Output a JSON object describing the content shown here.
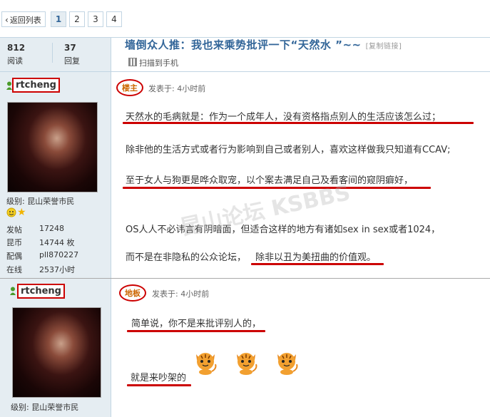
{
  "pager": {
    "back_label": "返回列表",
    "pages": [
      "1",
      "2",
      "3",
      "4"
    ],
    "current": "1"
  },
  "stats": {
    "views_num": "812",
    "views_label": "阅读",
    "replies_num": "37",
    "replies_label": "回复"
  },
  "thread": {
    "title": "墙倒众人推：我也来乘势批评一下“天然水 ”~~",
    "copy_link": "[复制链接]",
    "scan_label": "扫描到手机"
  },
  "post1": {
    "username": "rtcheng",
    "badge": "楼主",
    "time": "发表于: 4小时前",
    "level": "级别: 昆山荣誉市民",
    "info": [
      {
        "label": "发帖",
        "value": "17248"
      },
      {
        "label": "昆币",
        "value": "14744 枚"
      },
      {
        "label": "配偶",
        "value": "pll870227"
      },
      {
        "label": "在线",
        "value": "2537小时"
      }
    ],
    "lines": [
      "天然水的毛病就是：作为一个成年人，没有资格指点别人的生活应该怎么过；",
      "除非他的生活方式或者行为影响到自己或者别人，喜欢这样做我只知道有CCAV;",
      "至于女人与狗更是哗众取宠，以个案去满足自己及看客间的窥阴癖好，",
      "OS人人不必讳言有阴暗面，但适合这样的地方有诸如sex in sex或者1024，",
      "而不是在非隐私的公众论坛，",
      "除非以丑为美扭曲的价值观。"
    ]
  },
  "post2": {
    "username": "rtcheng",
    "badge": "地板",
    "time": "发表于: 4小时前",
    "level": "级别: 昆山荣誉市民",
    "lines": [
      "简单说，你不是来批评别人的，",
      "就是来吵架的"
    ]
  },
  "watermark": "昆山论坛 KSBBS",
  "colors": {
    "accent": "#336699",
    "highlight": "#cc0000",
    "sidebar_bg": "#e5edf2",
    "badge_text": "#cc6600"
  }
}
